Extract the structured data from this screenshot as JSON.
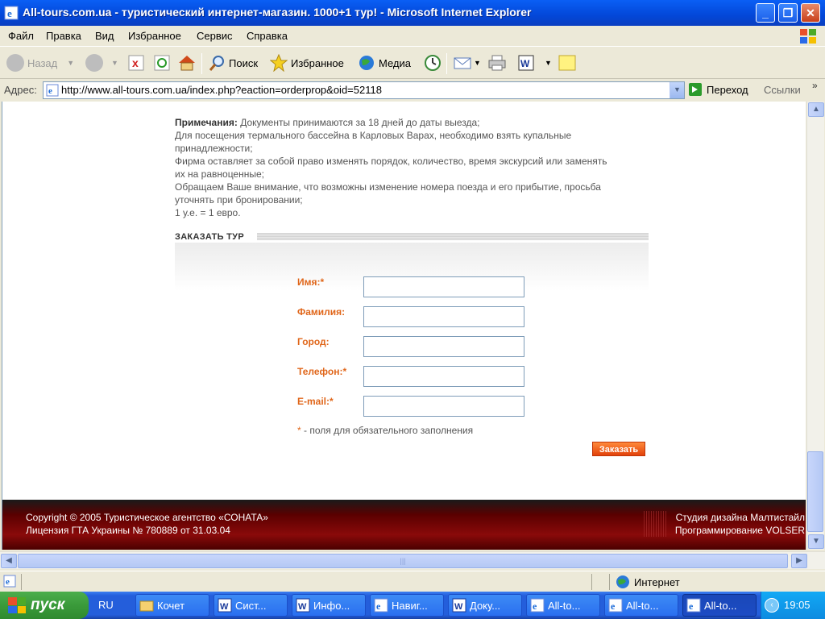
{
  "window": {
    "title": "All-tours.com.ua - туристический интернет-магазин. 1000+1 тур! - Microsoft Internet Explorer",
    "controls": [
      "minimize",
      "maximize",
      "close"
    ]
  },
  "menu": [
    "Файл",
    "Правка",
    "Вид",
    "Избранное",
    "Сервис",
    "Справка"
  ],
  "toolbar": {
    "back": "Назад",
    "search": "Поиск",
    "favorites": "Избранное",
    "media": "Медиа"
  },
  "address": {
    "label": "Адрес:",
    "url": "http://www.all-tours.com.ua/index.php?eaction=orderprop&oid=52118",
    "go": "Переход",
    "links": "Ссылки"
  },
  "page": {
    "notes_label": "Примечания:",
    "notes_lines": [
      "Документы принимаются за 18 дней до даты выезда;",
      "Для посещения термального бассейна в Карловых Варах, необходимо взять купальные",
      "принадлежности;",
      "Фирма оставляет за собой право изменять порядок, количество, время экскурсий или заменять",
      "их на равноценные;",
      "Обращаем Ваше внимание, что возможны изменение номера поезда и его прибытие, просьба",
      "уточнять при бронировании;",
      "1 у.е. = 1 евро."
    ],
    "section_title": "ЗАКАЗАТЬ ТУР",
    "form": {
      "name_label": "Имя:*",
      "surname_label": "Фамилия:",
      "city_label": "Город:",
      "phone_label": "Телефон:*",
      "email_label": "E-mail:*",
      "name_value": "",
      "surname_value": "",
      "city_value": "",
      "phone_value": "",
      "email_value": "",
      "required_star": "*",
      "required_note": " - поля для обязательного заполнения",
      "submit": "Заказать"
    },
    "footer": {
      "copyright": "Copyright © 2005 Туристическое агентство «СОНАТА»",
      "license": "Лицензия ГТА Украины № 780889 от 31.03.04",
      "design": "Студия дизайна Малтистайл",
      "programming": "Программирование VOLSER"
    }
  },
  "status": {
    "zone": "Интернет"
  },
  "taskbar": {
    "start": "пуск",
    "lang": "RU",
    "tasks": [
      "Кочет",
      "Сист...",
      "Инфо...",
      "Навиг...",
      "Доку...",
      "All-to...",
      "All-to...",
      "All-to..."
    ],
    "clock": "19:05"
  },
  "colors": {
    "accent_orange": "#e0661a",
    "footer_red": "#8a0a0a",
    "xp_blue": "#245edb"
  }
}
